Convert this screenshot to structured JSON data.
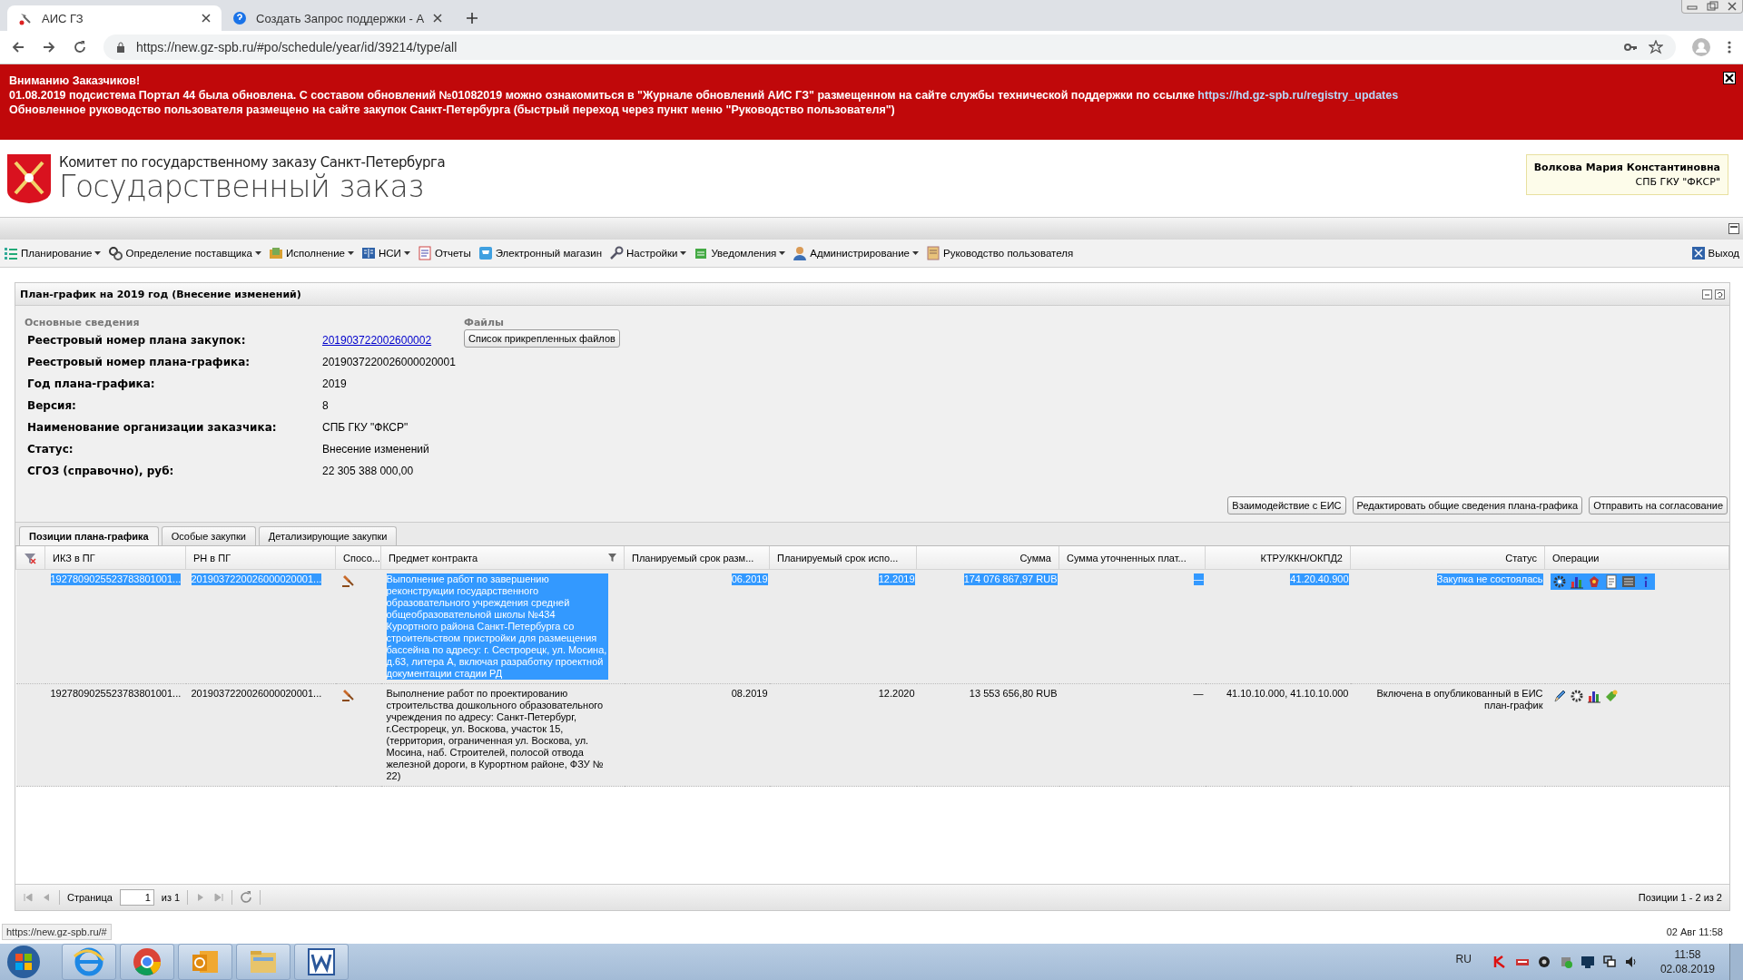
{
  "browser": {
    "tabs": [
      {
        "title": "АИС ГЗ",
        "selected": true
      },
      {
        "title": "Создать Запрос поддержки - А",
        "selected": false
      }
    ],
    "url": "https://new.gz-spb.ru/#po/schedule/year/id/39214/type/all"
  },
  "banner": {
    "title": "Вниманию Заказчиков!",
    "lines": [
      {
        "text": "01.08.2019 подсистема Портал 44 была обновлена. С составом обновлений №01082019 можно ознакомиться в \"Журнале обновлений АИС ГЗ\" размещенном на сайте службы технической поддержки по ссылке ",
        "link": "https://hd.gz-spb.ru/registry_updates"
      },
      {
        "text": "Обновленное руководство пользователя размещено на сайте закупок Санкт-Петербурга (быстрый переход через пункт меню \"Руководство пользователя\")"
      }
    ]
  },
  "header": {
    "subtitle": "Комитет по государственному заказу Санкт-Петербурга",
    "title": "Государственный заказ",
    "user": {
      "name": "Волкова Мария Константиновна",
      "org": "СПБ ГКУ \"ФКСР\""
    }
  },
  "menu": {
    "items": [
      {
        "label": "Планирование",
        "kind": "list",
        "dropdown": true
      },
      {
        "label": "Определение поставщика",
        "kind": "gears",
        "dropdown": true
      },
      {
        "label": "Исполнение",
        "kind": "folder",
        "dropdown": true
      },
      {
        "label": "НСИ",
        "kind": "book",
        "dropdown": true
      },
      {
        "label": "Отчеты",
        "kind": "report",
        "dropdown": false
      },
      {
        "label": "Электронный магазин",
        "kind": "cart",
        "dropdown": false
      },
      {
        "label": "Настройки",
        "kind": "wrench",
        "dropdown": true
      },
      {
        "label": "Уведомления",
        "kind": "tray",
        "dropdown": true
      },
      {
        "label": "Администрирование",
        "kind": "user",
        "dropdown": true
      },
      {
        "label": "Руководство пользователя",
        "kind": "manual",
        "dropdown": false
      }
    ],
    "exit": "Выход"
  },
  "panel": {
    "title": "План-график на 2019 год (Внесение изменений)",
    "section": "Основные сведения",
    "fields": [
      {
        "label": "Реестровый номер плана закупок:",
        "value": "201903722002600002",
        "kind": "link"
      },
      {
        "label": "Реестровый номер плана-графика:",
        "value": "2019037220026000020001",
        "kind": "text"
      },
      {
        "label": "Год плана-графика:",
        "value": "2019",
        "kind": "text"
      },
      {
        "label": "Версия:",
        "value": "8",
        "kind": "text"
      },
      {
        "label": "Наименование организации заказчика:",
        "value": "СПБ ГКУ \"ФКСР\"",
        "kind": "text"
      },
      {
        "label": "Статус:",
        "value": "Внесение изменений",
        "kind": "text"
      },
      {
        "label": "СГОЗ (справочно), руб:",
        "value": "22 305 388 000,00",
        "kind": "text"
      }
    ],
    "files": {
      "label": "Файлы",
      "button": "Список прикрепленных файлов"
    },
    "actions": [
      "Взаимодействие с ЕИС",
      "Редактировать общие сведения плана-графика",
      "Отправить на согласование"
    ],
    "tabs": [
      {
        "label": "Позиции плана-графика",
        "selected": true
      },
      {
        "label": "Особые закупки",
        "selected": false
      },
      {
        "label": "Детализирующие закупки",
        "selected": false
      }
    ],
    "table": {
      "columns": [
        {
          "label": "ИКЗ в ПГ",
          "filtered": false
        },
        {
          "label": "РН в ПГ",
          "filtered": false
        },
        {
          "label": "Спосо...",
          "filtered": false
        },
        {
          "label": "Предмет контракта",
          "filtered": true
        },
        {
          "label": "Планируемый срок разм...",
          "filtered": false
        },
        {
          "label": "Планируемый срок испо...",
          "filtered": false
        },
        {
          "label": "Сумма",
          "filtered": false
        },
        {
          "label": "Сумма уточненных плат...",
          "filtered": false
        },
        {
          "label": "КТРУ/ККН/ОКПД2",
          "filtered": false
        },
        {
          "label": "Статус",
          "filtered": false
        },
        {
          "label": "Операции",
          "filtered": false
        }
      ],
      "rows": [
        {
          "selected": true,
          "cells": [
            "1927809025523783801001...",
            "2019037220026000020001...",
            "",
            "Выполнение работ по завершению реконструкции государственного образовательного учреждения средней общеобразовательной школы №434 Курортного района Санкт-Петербурга со строительством пристройки для размещения бассейна по адресу: г. Сестрорецк, ул. Мосина, д.63, литера А, включая разработку проектной документации стадии РД",
            "06.2019",
            "12.2019",
            "174 076 867,97 RUB",
            "—",
            "41.20.40.900",
            "Закупка не состоялась"
          ],
          "operations": [
            {
              "kind": "gear"
            },
            {
              "kind": "chart"
            },
            {
              "kind": "emblem"
            },
            {
              "kind": "doc"
            },
            {
              "kind": "list"
            },
            {
              "kind": "info"
            }
          ]
        },
        {
          "selected": false,
          "cells": [
            "1927809025523783801001...",
            "2019037220026000020001...",
            "",
            "Выполнение работ по проектированию строительства дошкольного образовательного учреждения по адресу: Санкт-Петербург, г.Сестрорецк, ул. Воскова, участок 15, (территория, ограниченная ул. Воскова, ул. Мосина, наб. Строителей, полосой отвода железной дороги, в Курортном районе, ФЗУ № 22)",
            "08.2019",
            "12.2020",
            "13 553 656,80 RUB",
            "—",
            "41.10.10.000, 41.10.10.000",
            "Включена в опубликованный в ЕИС план-график"
          ],
          "operations": [
            {
              "kind": "pencil"
            },
            {
              "kind": "gear"
            },
            {
              "kind": "chart"
            },
            {
              "kind": "tag"
            }
          ]
        }
      ]
    },
    "pager": {
      "page_label": "Страница",
      "page": "1",
      "of": "из 1",
      "summary": "Позиции 1 - 2 из 2"
    }
  },
  "status_url": "https://new.gz-spb.ru/#",
  "status_time": "02 Авг 11:58",
  "taskbar": {
    "apps": [
      {
        "kind": "ie"
      },
      {
        "kind": "chrome"
      },
      {
        "kind": "outlook"
      },
      {
        "kind": "explorer"
      },
      {
        "kind": "word"
      }
    ],
    "lang": "RU",
    "time": "11:58",
    "date": "02.08.2019"
  }
}
